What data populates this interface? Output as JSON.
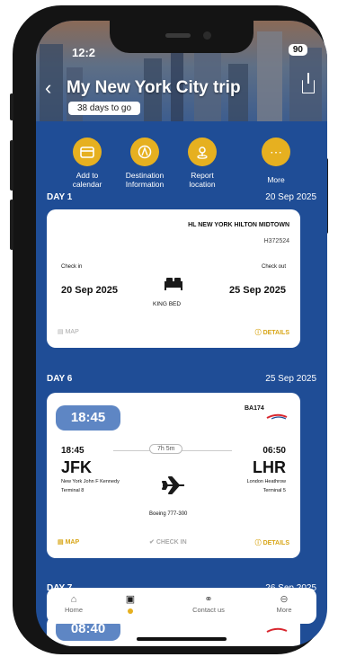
{
  "status_bar": {
    "time": "12:2",
    "battery": "90"
  },
  "header": {
    "title": "My New York City trip",
    "days_to_go": "38 days to go"
  },
  "actions": [
    {
      "label_1": "Add to",
      "label_2": "calendar",
      "icon": "calendar-icon"
    },
    {
      "label_1": "Destination",
      "label_2": "Information",
      "icon": "destination-icon"
    },
    {
      "label_1": "Report",
      "label_2": "location",
      "icon": "location-pin-icon"
    },
    {
      "label_1": "More",
      "label_2": "",
      "icon": "more-dots-icon"
    }
  ],
  "day1": {
    "label": "DAY 1",
    "date": "20 Sep 2025",
    "hotel": {
      "name": "HL NEW YORK HILTON MIDTOWN",
      "ref": "H372524",
      "checkin_label": "Check in",
      "checkin_date": "20 Sep 2025",
      "checkout_label": "Check out",
      "checkout_date": "25 Sep 2025",
      "room": "KING BED",
      "map_label": "MAP",
      "details_label": "DETAILS"
    }
  },
  "day6": {
    "label": "DAY 6",
    "date": "25 Sep 2025",
    "flight": {
      "departure_time_pill": "18:45",
      "flight_number": "BA174",
      "dep_time": "18:45",
      "duration": "7h 5m",
      "arr_time": "06:50",
      "dep_code": "JFK",
      "arr_code": "LHR",
      "dep_airport": "New York John F Kennedy",
      "dep_terminal": "Terminal 8",
      "arr_airport": "London Heathrow",
      "arr_terminal": "Terminal 5",
      "aircraft": "Boeing 777-300",
      "map_label": "MAP",
      "checkin_label": "CHECK IN",
      "details_label": "DETAILS"
    }
  },
  "next_day": {
    "label": "DAY 7",
    "date": "26 Sep 2025",
    "pill_time": "08:40"
  },
  "tabbar": {
    "home": "Home",
    "trips": "",
    "contact": "Contact us",
    "more": "More"
  },
  "colors": {
    "navy": "#1f4d96",
    "gold": "#e6b020",
    "pill_blue": "#5e86c4",
    "ba_red": "#d8262e"
  }
}
